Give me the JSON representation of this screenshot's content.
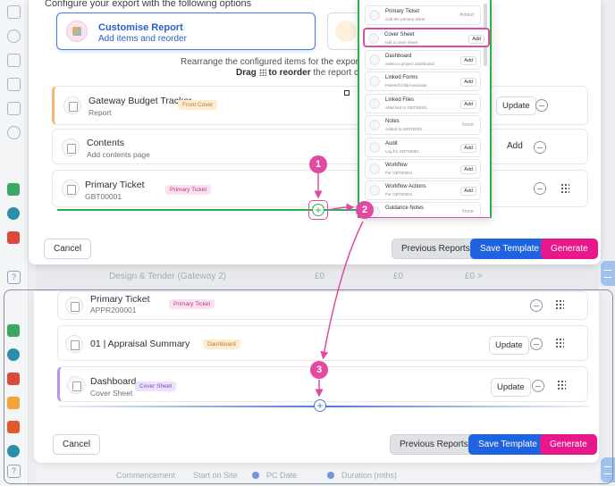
{
  "modal": {
    "header": "Configure your export with the following options",
    "customise": {
      "title": "Customise Report",
      "subtitle": "Add items and reorder"
    },
    "rearrange_line1": "Rearrange the configured items for the export. Add ite",
    "rearrange_bold1": "Drag",
    "rearrange_mid": "to reorder",
    "rearrange_line2_end": "the report contents to yo",
    "rows": [
      {
        "title": "Gateway Budget Tracker",
        "subtitle": "Report",
        "badge": "Front Cover",
        "action": "Update"
      },
      {
        "title": "Contents",
        "subtitle": "Add contents page",
        "action": "Add"
      },
      {
        "title": "Primary Ticket",
        "subtitle": "GBT00001",
        "badge": "Primary Ticket"
      }
    ],
    "footer": {
      "cancel": "Cancel",
      "previous": "Previous Reports",
      "save": "Save Template",
      "generate": "Generate"
    }
  },
  "dropdown": {
    "items": [
      {
        "name": "Primary Ticket",
        "desc": "Add the primary ticket",
        "action": "Added"
      },
      {
        "name": "Cover Sheet",
        "desc": "Add a cover sheet",
        "action": "Add"
      },
      {
        "name": "Dashboard",
        "desc": "Select a project dashboard",
        "action": "Add"
      },
      {
        "name": "Linked Forms",
        "desc": "Parent/Child/Associate",
        "action": "Add"
      },
      {
        "name": "Linked Files",
        "desc": "Attached to GBT00001",
        "action": "Add"
      },
      {
        "name": "Notes",
        "desc": "Added to GBT00001",
        "action": "None"
      },
      {
        "name": "Audit",
        "desc": "Log for GBT00001",
        "action": "Add"
      },
      {
        "name": "Workflow",
        "desc": "For GBT00001",
        "action": "Add"
      },
      {
        "name": "Workflow Actions",
        "desc": "For GBT00001",
        "action": "Add"
      },
      {
        "name": "Guidance Notes",
        "desc": "",
        "action": "None"
      }
    ]
  },
  "background": {
    "row_top": {
      "label": "Design & Tender (Gateway 2)",
      "v1": "£0",
      "v2": "£0",
      "v3": "£0 >"
    },
    "row_bottom": {
      "c1": "Commencement",
      "c2": "Start on Site",
      "c3": "PC Date",
      "c4": "Duration (mths)"
    }
  },
  "panel2": {
    "rows": [
      {
        "title": "Primary Ticket",
        "subtitle": "APPR200001",
        "badge": "Primary Ticket"
      },
      {
        "title": "01 | Appraisal Summary",
        "badge": "Dashboard",
        "action": "Update"
      },
      {
        "title": "Dashboard",
        "subtitle": "Cover Sheet",
        "badge": "Cover Sheet",
        "action": "Update"
      }
    ],
    "footer": {
      "cancel": "Cancel",
      "previous": "Previous Reports",
      "save": "Save Template",
      "generate": "Generate"
    }
  },
  "annotations": {
    "step1": "1",
    "step2": "2",
    "step3": "3"
  },
  "colors": {
    "accent_pink": "#e04aa0",
    "accent_green": "#2ab24b",
    "primary_blue": "#1f63e0",
    "generate_pink": "#e8178b"
  }
}
